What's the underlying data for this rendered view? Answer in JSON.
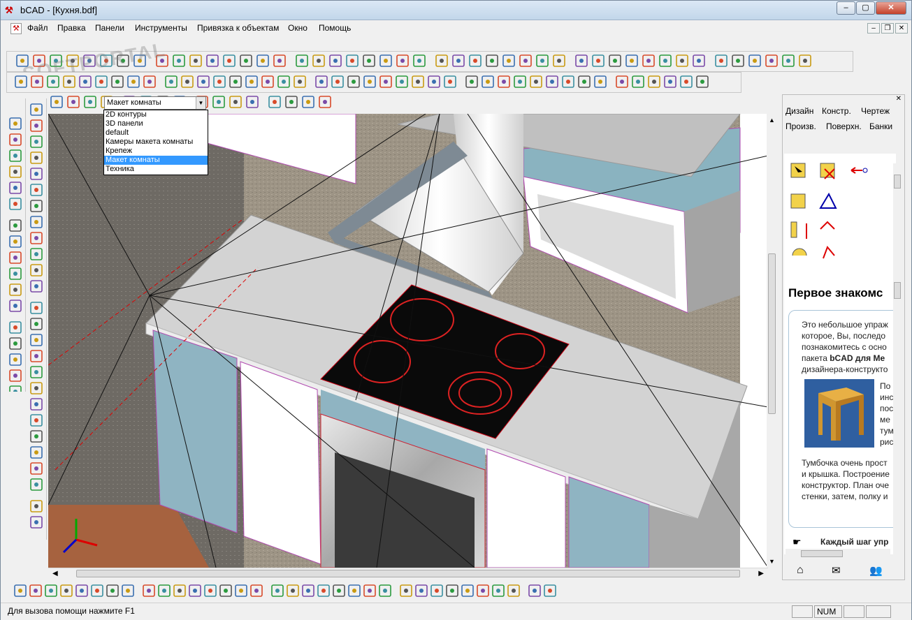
{
  "window": {
    "title": "bCAD - [Кухня.bdf]",
    "app_icon": "bcad-logo-icon"
  },
  "menu": [
    {
      "label": "Файл"
    },
    {
      "label": "Правка"
    },
    {
      "label": "Панели"
    },
    {
      "label": "Инструменты"
    },
    {
      "label": "Привязка к объектам"
    },
    {
      "label": "Окно"
    },
    {
      "label": "Помощь"
    }
  ],
  "watermark": "SOFTPORTAL",
  "layer_combo": {
    "value": "Макет комнаты",
    "options": [
      "2D контуры",
      "3D панели",
      "default",
      "Камеры макета комнаты",
      "Крепеж",
      "Макет комнаты",
      "Техника"
    ],
    "selected_index": 5
  },
  "right_panel": {
    "tabs": [
      "Дизайн",
      "Констр.",
      "Чертеж",
      "Произв.",
      "Поверхн.",
      "Банки"
    ],
    "help_title": "Первое знакомс",
    "intro_lines": [
      "Это небольшое упраж",
      "которое, Вы, последо",
      "познакомитесь с осно",
      "пакета",
      "дизайнера-конструкто"
    ],
    "intro_bold": "bCAD для Ме",
    "side_lines": [
      "По",
      "инс",
      "пос",
      "ме",
      "тум",
      "рис"
    ],
    "para2_lines": [
      "Тумбочка очень прост",
      "и крышка. Построение",
      "конструктор. План оче",
      "стенки, затем, полку и"
    ],
    "step_text": "Каждый шаг упр"
  },
  "status": {
    "hint": "Для вызова помощи нажмите F1",
    "num": "NUM"
  }
}
